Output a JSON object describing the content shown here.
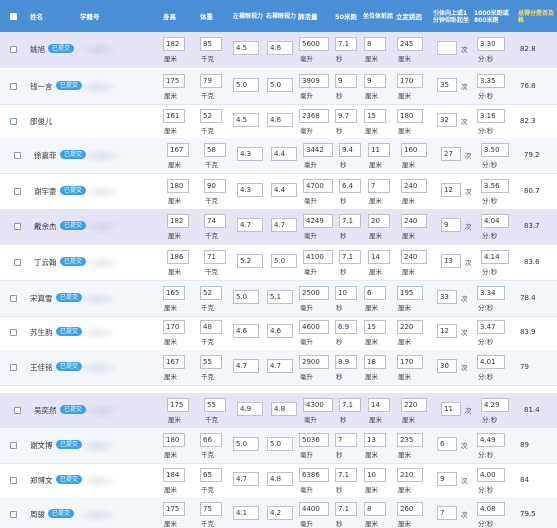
{
  "columns": {
    "name": "姓名",
    "student_no": "学籍号",
    "height": "身高",
    "weight": "体重",
    "left_vision": "左裸眼视力",
    "right_vision": "右裸眼视力",
    "vital_capacity": "肺活量",
    "sprint_50m": "50米跑",
    "sit_reach": "坐位体前屈",
    "long_jump": "立定跳远",
    "pullup_situp": "引体向上或1分钟仰卧起坐",
    "run_long": "1000米跑或800米跑",
    "total": "总得分是否及格"
  },
  "units": {
    "height": "厘米",
    "weight": "千克",
    "vital_capacity": "毫升",
    "sprint_50m": "秒",
    "sit_reach": "厘米",
    "long_jump": "厘米",
    "pullup_situp": "次",
    "run_long": "分:秒"
  },
  "status_label": "已提交",
  "rows": [
    {
      "name": "姚旭",
      "height": "182",
      "weight": "85",
      "left_vision": "4.5",
      "right_vision": "4.6",
      "vital_capacity": "5600",
      "sprint_50m": "7.1",
      "sit_reach": "8",
      "long_jump": "245",
      "pullup_situp": "",
      "run_long": "3.30",
      "score": "82.8",
      "show_status": true,
      "highlight": true
    },
    {
      "name": "钱一言",
      "height": "175",
      "weight": "79",
      "left_vision": "5.0",
      "right_vision": "5.0",
      "vital_capacity": "3909",
      "sprint_50m": "9",
      "sit_reach": "9",
      "long_jump": "170",
      "pullup_situp": "35",
      "run_long": "3.35",
      "score": "76.8",
      "show_status": true,
      "highlight": false
    },
    {
      "name": "邵俊儿",
      "height": "161",
      "weight": "52",
      "left_vision": "4.5",
      "right_vision": "4.6",
      "vital_capacity": "2368",
      "sprint_50m": "9.7",
      "sit_reach": "15",
      "long_jump": "180",
      "pullup_situp": "32",
      "run_long": "3.16",
      "score": "82.3",
      "show_status": false,
      "highlight": false
    },
    {
      "name": "徐嘉菲",
      "height": "167",
      "weight": "58",
      "left_vision": "4.3",
      "right_vision": "4.4",
      "vital_capacity": "3442",
      "sprint_50m": "9.4",
      "sit_reach": "11",
      "long_jump": "160",
      "pullup_situp": "27",
      "run_long": "3.50",
      "score": "79.2",
      "show_status": true,
      "highlight": false
    },
    {
      "name": "谢宇豪",
      "height": "180",
      "weight": "90",
      "left_vision": "4.3",
      "right_vision": "4.4",
      "vital_capacity": "4700",
      "sprint_50m": "6.4",
      "sit_reach": "7",
      "long_jump": "240",
      "pullup_situp": "12",
      "run_long": "3.56",
      "score": "80.7",
      "show_status": true,
      "highlight": false
    },
    {
      "name": "戴余杰",
      "height": "182",
      "weight": "74",
      "left_vision": "4.7",
      "right_vision": "4.7",
      "vital_capacity": "4249",
      "sprint_50m": "7.1",
      "sit_reach": "20",
      "long_jump": "240",
      "pullup_situp": "9",
      "run_long": "4.04",
      "score": "83.7",
      "show_status": true,
      "highlight": true
    },
    {
      "name": "丁云翰",
      "height": "186",
      "weight": "71",
      "left_vision": "5.2",
      "right_vision": "5.0",
      "vital_capacity": "4100",
      "sprint_50m": "7.1",
      "sit_reach": "14",
      "long_jump": "240",
      "pullup_situp": "13",
      "run_long": "4.14",
      "score": "83.6",
      "show_status": true,
      "highlight": false
    },
    {
      "name": "宋真雪",
      "height": "165",
      "weight": "52",
      "left_vision": "5.0",
      "right_vision": "5.1",
      "vital_capacity": "2500",
      "sprint_50m": "10",
      "sit_reach": "6",
      "long_jump": "195",
      "pullup_situp": "33",
      "run_long": "3.34",
      "score": "78.4",
      "show_status": true,
      "highlight": false
    },
    {
      "name": "苏生韵",
      "height": "170",
      "weight": "48",
      "left_vision": "4.6",
      "right_vision": "4.6",
      "vital_capacity": "4600",
      "sprint_50m": "6.9",
      "sit_reach": "15",
      "long_jump": "220",
      "pullup_situp": "12",
      "run_long": "3.47",
      "score": "83.9",
      "show_status": true,
      "highlight": false
    },
    {
      "name": "王佳铭",
      "height": "167",
      "weight": "55",
      "left_vision": "4.7",
      "right_vision": "4.7",
      "vital_capacity": "2900",
      "sprint_50m": "8.9",
      "sit_reach": "18",
      "long_jump": "170",
      "pullup_situp": "30",
      "run_long": "4.01",
      "score": "79",
      "show_status": true,
      "highlight": false
    },
    {
      "name": "吴奕然",
      "height": "175",
      "weight": "55",
      "left_vision": "4.9",
      "right_vision": "4.8",
      "vital_capacity": "4300",
      "sprint_50m": "7.1",
      "sit_reach": "14",
      "long_jump": "220",
      "pullup_situp": "11",
      "run_long": "4.29",
      "score": "81.4",
      "show_status": true,
      "highlight": true
    },
    {
      "name": "谢文博",
      "height": "180",
      "weight": "66",
      "left_vision": "5.0",
      "right_vision": "5.0",
      "vital_capacity": "5036",
      "sprint_50m": "7",
      "sit_reach": "13",
      "long_jump": "235",
      "pullup_situp": "6",
      "run_long": "4.49",
      "score": "89",
      "show_status": true,
      "highlight": false
    },
    {
      "name": "郑博文",
      "height": "184",
      "weight": "65",
      "left_vision": "4.7",
      "right_vision": "4.8",
      "vital_capacity": "6386",
      "sprint_50m": "7.1",
      "sit_reach": "10",
      "long_jump": "210",
      "pullup_situp": "9",
      "run_long": "4.00",
      "score": "84",
      "show_status": true,
      "highlight": false
    },
    {
      "name": "周骏",
      "height": "175",
      "weight": "75",
      "left_vision": "4.1",
      "right_vision": "4.2",
      "vital_capacity": "4400",
      "sprint_50m": "7.1",
      "sit_reach": "8",
      "long_jump": "260",
      "pullup_situp": "7",
      "run_long": "4.08",
      "score": "79.5",
      "show_status": true,
      "highlight": false
    }
  ]
}
